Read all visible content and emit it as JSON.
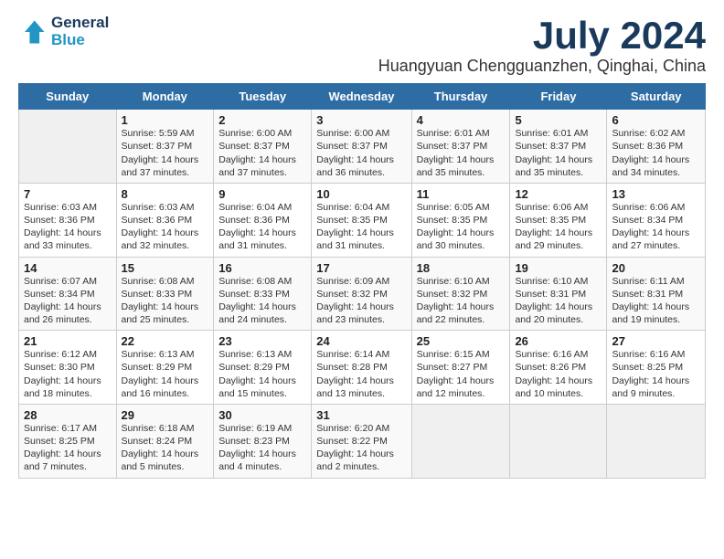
{
  "header": {
    "logo_line1": "General",
    "logo_line2": "Blue",
    "title": "July 2024",
    "subtitle": "Huangyuan Chengguanzhen, Qinghai, China"
  },
  "columns": [
    "Sunday",
    "Monday",
    "Tuesday",
    "Wednesday",
    "Thursday",
    "Friday",
    "Saturday"
  ],
  "weeks": [
    [
      {
        "day": "",
        "sunrise": "",
        "sunset": "",
        "daylight": ""
      },
      {
        "day": "1",
        "sunrise": "Sunrise: 5:59 AM",
        "sunset": "Sunset: 8:37 PM",
        "daylight": "Daylight: 14 hours and 37 minutes."
      },
      {
        "day": "2",
        "sunrise": "Sunrise: 6:00 AM",
        "sunset": "Sunset: 8:37 PM",
        "daylight": "Daylight: 14 hours and 37 minutes."
      },
      {
        "day": "3",
        "sunrise": "Sunrise: 6:00 AM",
        "sunset": "Sunset: 8:37 PM",
        "daylight": "Daylight: 14 hours and 36 minutes."
      },
      {
        "day": "4",
        "sunrise": "Sunrise: 6:01 AM",
        "sunset": "Sunset: 8:37 PM",
        "daylight": "Daylight: 14 hours and 35 minutes."
      },
      {
        "day": "5",
        "sunrise": "Sunrise: 6:01 AM",
        "sunset": "Sunset: 8:37 PM",
        "daylight": "Daylight: 14 hours and 35 minutes."
      },
      {
        "day": "6",
        "sunrise": "Sunrise: 6:02 AM",
        "sunset": "Sunset: 8:36 PM",
        "daylight": "Daylight: 14 hours and 34 minutes."
      }
    ],
    [
      {
        "day": "7",
        "sunrise": "Sunrise: 6:03 AM",
        "sunset": "Sunset: 8:36 PM",
        "daylight": "Daylight: 14 hours and 33 minutes."
      },
      {
        "day": "8",
        "sunrise": "Sunrise: 6:03 AM",
        "sunset": "Sunset: 8:36 PM",
        "daylight": "Daylight: 14 hours and 32 minutes."
      },
      {
        "day": "9",
        "sunrise": "Sunrise: 6:04 AM",
        "sunset": "Sunset: 8:36 PM",
        "daylight": "Daylight: 14 hours and 31 minutes."
      },
      {
        "day": "10",
        "sunrise": "Sunrise: 6:04 AM",
        "sunset": "Sunset: 8:35 PM",
        "daylight": "Daylight: 14 hours and 31 minutes."
      },
      {
        "day": "11",
        "sunrise": "Sunrise: 6:05 AM",
        "sunset": "Sunset: 8:35 PM",
        "daylight": "Daylight: 14 hours and 30 minutes."
      },
      {
        "day": "12",
        "sunrise": "Sunrise: 6:06 AM",
        "sunset": "Sunset: 8:35 PM",
        "daylight": "Daylight: 14 hours and 29 minutes."
      },
      {
        "day": "13",
        "sunrise": "Sunrise: 6:06 AM",
        "sunset": "Sunset: 8:34 PM",
        "daylight": "Daylight: 14 hours and 27 minutes."
      }
    ],
    [
      {
        "day": "14",
        "sunrise": "Sunrise: 6:07 AM",
        "sunset": "Sunset: 8:34 PM",
        "daylight": "Daylight: 14 hours and 26 minutes."
      },
      {
        "day": "15",
        "sunrise": "Sunrise: 6:08 AM",
        "sunset": "Sunset: 8:33 PM",
        "daylight": "Daylight: 14 hours and 25 minutes."
      },
      {
        "day": "16",
        "sunrise": "Sunrise: 6:08 AM",
        "sunset": "Sunset: 8:33 PM",
        "daylight": "Daylight: 14 hours and 24 minutes."
      },
      {
        "day": "17",
        "sunrise": "Sunrise: 6:09 AM",
        "sunset": "Sunset: 8:32 PM",
        "daylight": "Daylight: 14 hours and 23 minutes."
      },
      {
        "day": "18",
        "sunrise": "Sunrise: 6:10 AM",
        "sunset": "Sunset: 8:32 PM",
        "daylight": "Daylight: 14 hours and 22 minutes."
      },
      {
        "day": "19",
        "sunrise": "Sunrise: 6:10 AM",
        "sunset": "Sunset: 8:31 PM",
        "daylight": "Daylight: 14 hours and 20 minutes."
      },
      {
        "day": "20",
        "sunrise": "Sunrise: 6:11 AM",
        "sunset": "Sunset: 8:31 PM",
        "daylight": "Daylight: 14 hours and 19 minutes."
      }
    ],
    [
      {
        "day": "21",
        "sunrise": "Sunrise: 6:12 AM",
        "sunset": "Sunset: 8:30 PM",
        "daylight": "Daylight: 14 hours and 18 minutes."
      },
      {
        "day": "22",
        "sunrise": "Sunrise: 6:13 AM",
        "sunset": "Sunset: 8:29 PM",
        "daylight": "Daylight: 14 hours and 16 minutes."
      },
      {
        "day": "23",
        "sunrise": "Sunrise: 6:13 AM",
        "sunset": "Sunset: 8:29 PM",
        "daylight": "Daylight: 14 hours and 15 minutes."
      },
      {
        "day": "24",
        "sunrise": "Sunrise: 6:14 AM",
        "sunset": "Sunset: 8:28 PM",
        "daylight": "Daylight: 14 hours and 13 minutes."
      },
      {
        "day": "25",
        "sunrise": "Sunrise: 6:15 AM",
        "sunset": "Sunset: 8:27 PM",
        "daylight": "Daylight: 14 hours and 12 minutes."
      },
      {
        "day": "26",
        "sunrise": "Sunrise: 6:16 AM",
        "sunset": "Sunset: 8:26 PM",
        "daylight": "Daylight: 14 hours and 10 minutes."
      },
      {
        "day": "27",
        "sunrise": "Sunrise: 6:16 AM",
        "sunset": "Sunset: 8:25 PM",
        "daylight": "Daylight: 14 hours and 9 minutes."
      }
    ],
    [
      {
        "day": "28",
        "sunrise": "Sunrise: 6:17 AM",
        "sunset": "Sunset: 8:25 PM",
        "daylight": "Daylight: 14 hours and 7 minutes."
      },
      {
        "day": "29",
        "sunrise": "Sunrise: 6:18 AM",
        "sunset": "Sunset: 8:24 PM",
        "daylight": "Daylight: 14 hours and 5 minutes."
      },
      {
        "day": "30",
        "sunrise": "Sunrise: 6:19 AM",
        "sunset": "Sunset: 8:23 PM",
        "daylight": "Daylight: 14 hours and 4 minutes."
      },
      {
        "day": "31",
        "sunrise": "Sunrise: 6:20 AM",
        "sunset": "Sunset: 8:22 PM",
        "daylight": "Daylight: 14 hours and 2 minutes."
      },
      {
        "day": "",
        "sunrise": "",
        "sunset": "",
        "daylight": ""
      },
      {
        "day": "",
        "sunrise": "",
        "sunset": "",
        "daylight": ""
      },
      {
        "day": "",
        "sunrise": "",
        "sunset": "",
        "daylight": ""
      }
    ]
  ]
}
